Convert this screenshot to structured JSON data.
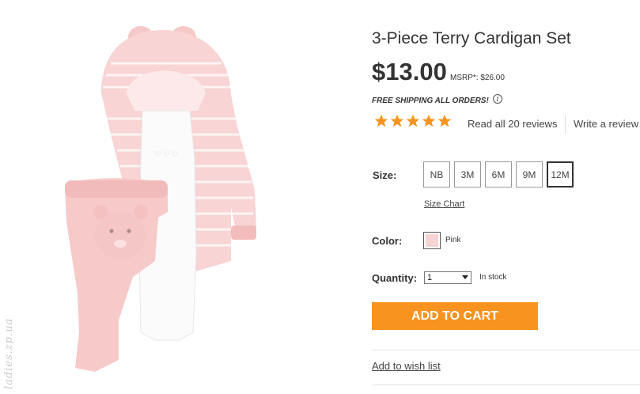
{
  "product": {
    "title": "3-Piece Terry Cardigan Set",
    "price": "$13.00",
    "msrp": "MSRP*: $26.00",
    "shipping": "FREE SHIPPING ALL ORDERS!",
    "info_icon_glyph": "i",
    "image_watermark": "ladies.zp.ua"
  },
  "reviews": {
    "rating": 5,
    "max_rating": 5,
    "star_color": "#f7931e",
    "read_label": "Read all 20 reviews",
    "write_label": "Write a review"
  },
  "size": {
    "label": "Size:",
    "options": [
      "NB",
      "3M",
      "6M",
      "9M",
      "12M"
    ],
    "selected": "12M",
    "chart_link": "Size Chart"
  },
  "color": {
    "label": "Color:",
    "name": "Pink",
    "swatch_hex": "#f6d3d3"
  },
  "quantity": {
    "label": "Quantity:",
    "value": "1",
    "stock": "In stock"
  },
  "actions": {
    "add_to_cart": "ADD TO CART",
    "add_to_cart_color": "#f7931e",
    "wishlist": "Add to wish list"
  }
}
